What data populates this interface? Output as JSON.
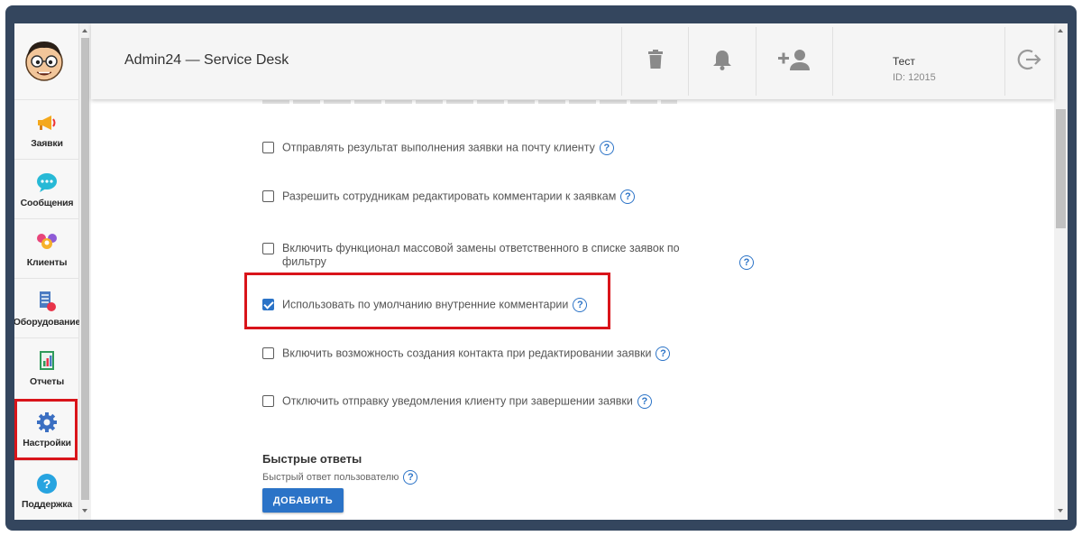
{
  "header": {
    "app_title": "Admin24 — Service Desk",
    "user_name": "Тест",
    "user_id": "ID: 12015"
  },
  "sidebar": {
    "items": [
      {
        "label": "Заявки",
        "icon": "megaphone-icon"
      },
      {
        "label": "Сообщения",
        "icon": "chat-bubble-icon"
      },
      {
        "label": "Клиенты",
        "icon": "people-icon"
      },
      {
        "label": "Оборудование",
        "icon": "equipment-icon"
      },
      {
        "label": "Отчеты",
        "icon": "report-icon"
      },
      {
        "label": "Настройки",
        "icon": "gear-icon",
        "active": true
      },
      {
        "label": "Поддержка",
        "icon": "help-circle-icon"
      }
    ]
  },
  "settings": {
    "options": [
      {
        "label": "Отправлять результат выполнения заявки на почту клиенту",
        "checked": false
      },
      {
        "label": "Разрешить сотрудникам редактировать комментарии к заявкам",
        "checked": false
      },
      {
        "label_line1": "Включить функционал массовой замены ответственного в списке заявок по",
        "label_line2": "фильтру",
        "checked": false
      },
      {
        "label": "Использовать по умолчанию внутренние комментарии",
        "checked": true
      },
      {
        "label": "Включить возможность создания контакта при редактировании заявки",
        "checked": false
      },
      {
        "label": "Отключить отправку уведомления клиенту при завершении заявки",
        "checked": false
      }
    ],
    "help_glyph": "?"
  },
  "quick_replies": {
    "title": "Быстрые ответы",
    "subtitle": "Быстрый ответ пользователю",
    "add_button": "ДОБАВИТЬ"
  },
  "colors": {
    "accent": "#2b73c7",
    "highlight": "#d9141a",
    "frame": "#34465e"
  }
}
